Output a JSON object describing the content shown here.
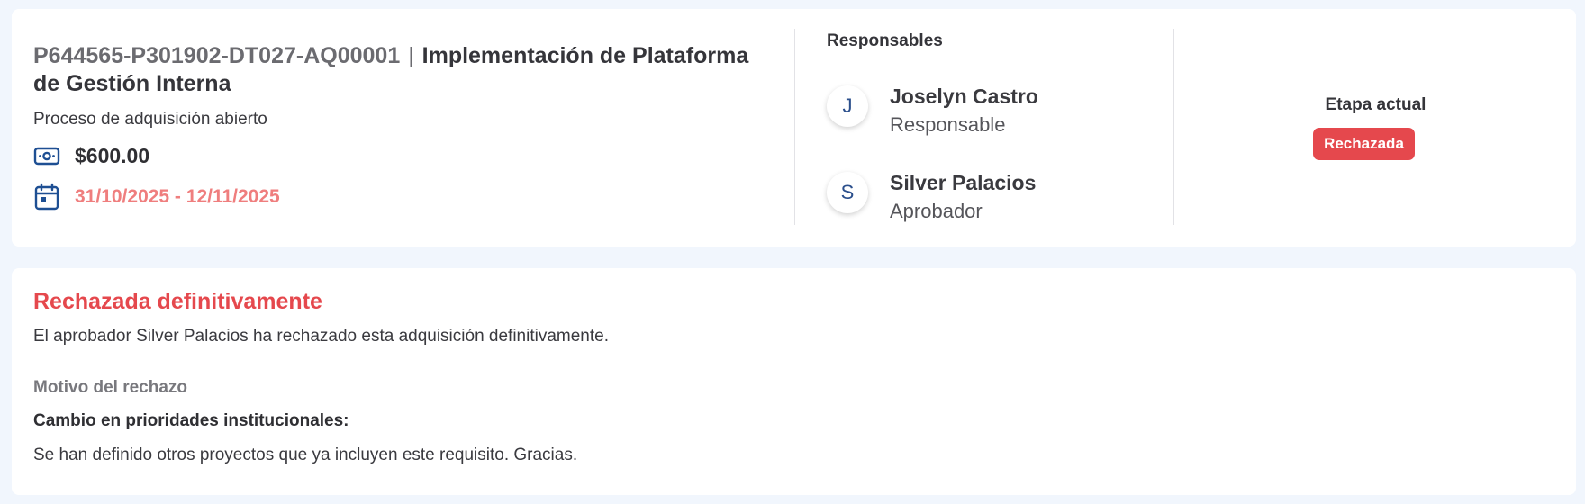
{
  "summary": {
    "code": "P644565-P301902-DT027-AQ00001",
    "separator": "|",
    "name": "Implementación de Plataforma de Gestión Interna",
    "process_type": "Proceso de adquisición abierto",
    "amount": "$600.00",
    "amount_icon": "money-icon",
    "date_range": "31/10/2025 - 12/11/2025",
    "date_icon": "calendar-icon"
  },
  "responsables": {
    "heading": "Responsables",
    "people": [
      {
        "initial": "J",
        "name": "Joselyn Castro",
        "role": "Responsable"
      },
      {
        "initial": "S",
        "name": "Silver Palacios",
        "role": "Aprobador"
      }
    ]
  },
  "stage": {
    "label": "Etapa actual",
    "badge": "Rechazada",
    "badge_color": "#e5484d"
  },
  "rejection": {
    "title": "Rechazada definitivamente",
    "description": "El aprobador Silver Palacios ha rechazado esta adquisición definitivamente.",
    "reason_label": "Motivo del rechazo",
    "reason_title": "Cambio en prioridades institucionales:",
    "reason_text": "Se han definido otros proyectos que ya incluyen este requisito. Gracias."
  },
  "colors": {
    "accent_red": "#e5484d",
    "date_red": "#ef7e7e",
    "icon_blue": "#1e4f93",
    "page_bg": "#f1f6fd"
  }
}
